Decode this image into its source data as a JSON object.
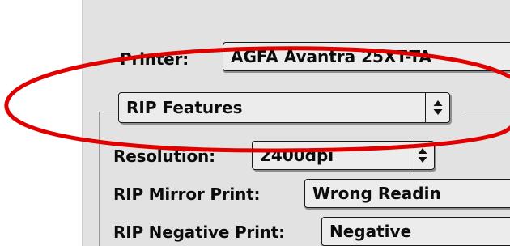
{
  "printer": {
    "label": "Printer:",
    "value": "AGFA Avantra 25XT-TA"
  },
  "panel_selector": {
    "value": "RIP Features"
  },
  "resolution": {
    "label": "Resolution:",
    "value": "2400dpi"
  },
  "mirror_print": {
    "label": "RIP Mirror Print:",
    "value": "Wrong Readin"
  },
  "negative_print": {
    "label": "RIP Negative Print:",
    "value": "Negative"
  },
  "annotation": {
    "color": "#e00000"
  },
  "icons": {
    "popup_arrows": "up-down-arrows-icon"
  }
}
